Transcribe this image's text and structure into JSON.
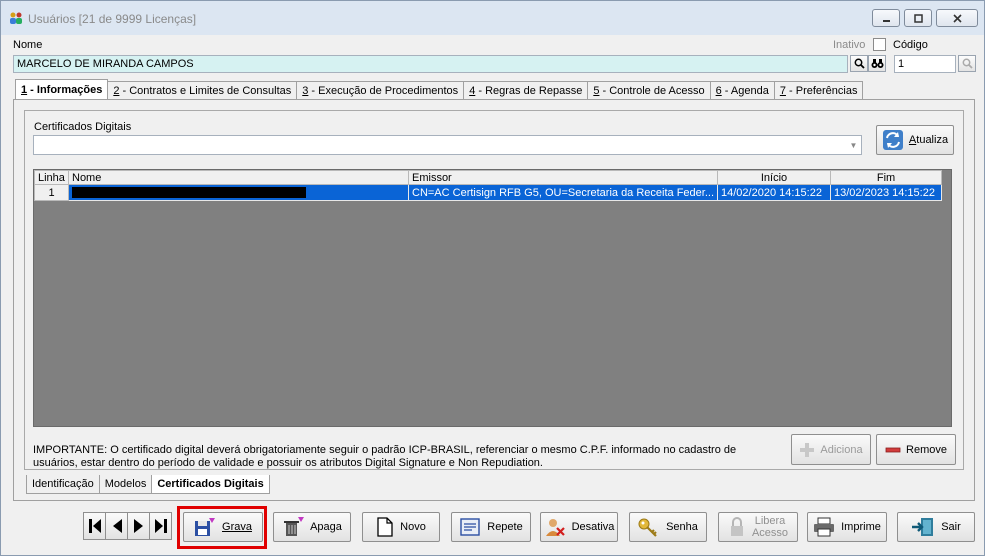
{
  "window": {
    "title": "Usuários [21 de 9999 Licenças]"
  },
  "header": {
    "nome_label": "Nome",
    "nome_value": "MARCELO DE MIRANDA CAMPOS",
    "inativo_label": "Inativo",
    "codigo_label": "Código",
    "codigo_value": "1"
  },
  "tabs": [
    {
      "num": "1",
      "label": " - Informações"
    },
    {
      "num": "2",
      "label": " - Contratos e Limites de Consultas"
    },
    {
      "num": "3",
      "label": " - Execução de Procedimentos"
    },
    {
      "num": "4",
      "label": " - Regras de Repasse"
    },
    {
      "num": "5",
      "label": " - Controle de Acesso"
    },
    {
      "num": "6",
      "label": " - Agenda"
    },
    {
      "num": "7",
      "label": " - Preferências"
    }
  ],
  "certificados": {
    "label": "Certificados Digitais",
    "atualiza_label": "tualiza",
    "atualiza_accel": "A",
    "columns": {
      "linha": "Linha",
      "nome": "Nome",
      "emissor": "Emissor",
      "inicio": "Início",
      "fim": "Fim"
    },
    "rows": [
      {
        "linha": "1",
        "emissor": "CN=AC Certisign RFB G5, OU=Secretaria da Receita Feder...",
        "inicio": "14/02/2020 14:15:22",
        "fim": "13/02/2023 14:15:22"
      }
    ],
    "note": "IMPORTANTE: O certificado digital deverá obrigatoriamente seguir o padrão ICP-BRASIL, referenciar o mesmo C.P.F. informado no cadastro de usuários, estar dentro do período de validade e possuir os atributos Digital Signature e Non Repudiation.",
    "adiciona_label": "Adiciona",
    "remove_label": "Remove"
  },
  "subtabs": [
    "Identificação",
    "Modelos",
    "Certificados Digitais"
  ],
  "toolbar": {
    "grava": "Grava",
    "apaga": "Apaga",
    "novo": "Novo",
    "repete": "Repete",
    "desativa": "Desativa",
    "senha": "Senha",
    "libera_1": "Libera",
    "libera_2": "Acesso",
    "imprime": "Imprime",
    "sair": "Sair"
  },
  "colors": {
    "selection": "#0a64d6",
    "highlight": "#e00000",
    "name_field": "#d6f2f2"
  }
}
